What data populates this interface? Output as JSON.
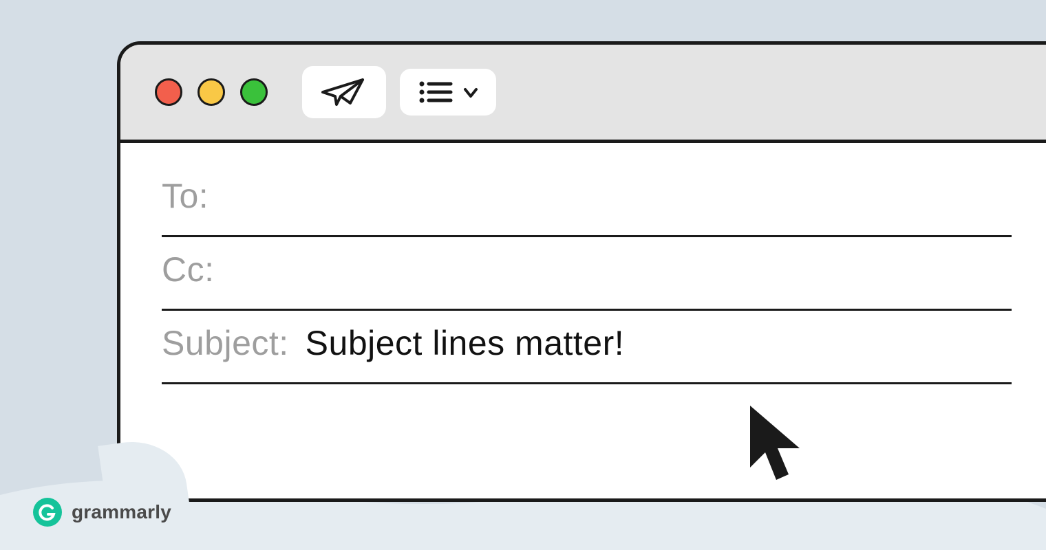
{
  "compose": {
    "fields": {
      "to": {
        "label": "To:",
        "value": ""
      },
      "cc": {
        "label": "Cc:",
        "value": ""
      },
      "subject": {
        "label": "Subject:",
        "value": "Subject lines matter!"
      }
    },
    "toolbar": {
      "send_icon": "paper-plane-icon",
      "format_icon": "list-icon"
    },
    "traffic_lights": {
      "close_color": "#f25f4c",
      "minimize_color": "#f9c846",
      "zoom_color": "#3ac13b"
    }
  },
  "branding": {
    "name": "grammarly",
    "badge_letter": "G"
  },
  "colors": {
    "page_bg": "#d5dee6",
    "wave": "#e5ecf1",
    "ink": "#1a1a1a",
    "muted": "#9e9e9e"
  }
}
